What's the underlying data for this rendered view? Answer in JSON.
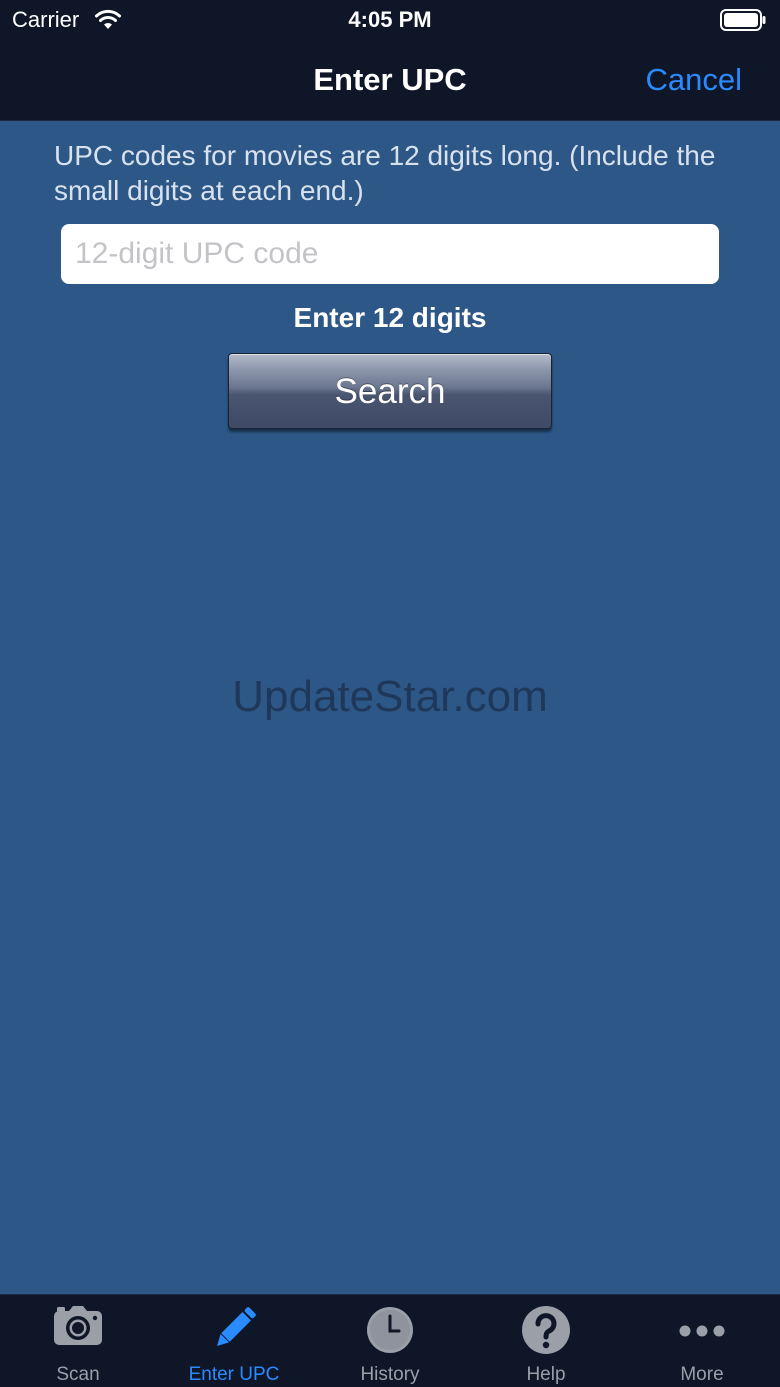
{
  "status_bar": {
    "carrier": "Carrier",
    "time": "4:05 PM"
  },
  "nav": {
    "title": "Enter UPC",
    "cancel_label": "Cancel"
  },
  "form": {
    "instructions": "UPC codes for movies are 12 digits long. (Include the small digits at each end.)",
    "input_value": "",
    "input_placeholder": "12-digit UPC code",
    "hint": "Enter 12 digits",
    "search_label": "Search"
  },
  "watermark": "UpdateStar.com",
  "tabs": [
    {
      "label": "Scan",
      "icon": "camera-icon",
      "active": false
    },
    {
      "label": "Enter UPC",
      "icon": "pencil-icon",
      "active": true
    },
    {
      "label": "History",
      "icon": "clock-icon",
      "active": false
    },
    {
      "label": "Help",
      "icon": "question-icon",
      "active": false
    },
    {
      "label": "More",
      "icon": "more-icon",
      "active": false
    }
  ],
  "colors": {
    "background": "#2c5786",
    "bar": "#0e1628",
    "accent": "#2a8bff",
    "inactive_tab": "#9a9fa8"
  }
}
